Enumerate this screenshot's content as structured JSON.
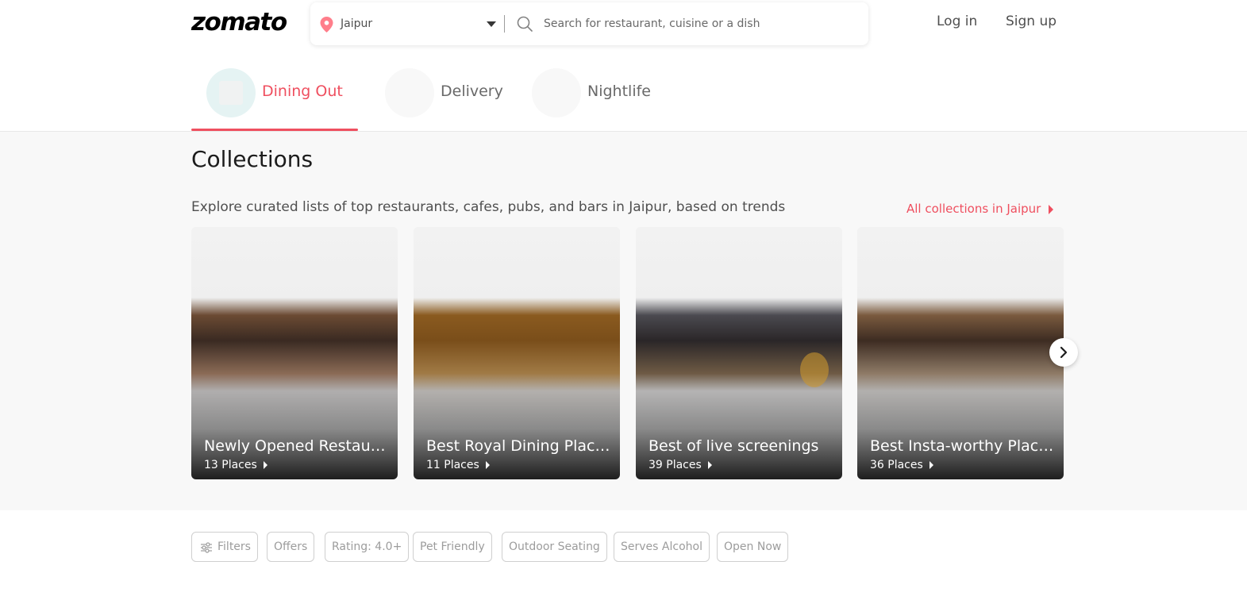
{
  "header": {
    "logo": "zomato",
    "location": "Jaipur",
    "search_placeholder": "Search for restaurant, cuisine or a dish",
    "login": "Log in",
    "signup": "Sign up"
  },
  "tabs": [
    {
      "label": "Dining Out",
      "active": true
    },
    {
      "label": "Delivery",
      "active": false
    },
    {
      "label": "Nightlife",
      "active": false
    }
  ],
  "collections": {
    "title": "Collections",
    "subtitle": "Explore curated lists of top restaurants, cafes, pubs, and bars in Jaipur, based on trends",
    "all_link": "All collections in Jaipur",
    "cards": [
      {
        "title": "Newly Opened Restaurants",
        "count": "13 Places"
      },
      {
        "title": "Best Royal Dining Places",
        "count": "11 Places"
      },
      {
        "title": "Best of live screenings",
        "count": "39 Places"
      },
      {
        "title": "Best Insta-worthy Places",
        "count": "36 Places"
      }
    ]
  },
  "filters": [
    "Filters",
    "Offers",
    "Rating: 4.0+",
    "Pet Friendly",
    "Outdoor Seating",
    "Serves Alcohol",
    "Open Now"
  ],
  "colors": {
    "brand_red": "#ef4f5f",
    "text_dark": "#1c1c1c",
    "text_muted": "#696969",
    "section_bg": "#f8f8f8"
  },
  "icons": {
    "location": "location-pin-icon",
    "dropdown": "caret-down-icon",
    "search": "search-icon",
    "next": "chevron-right-icon",
    "filters": "sliders-icon"
  }
}
